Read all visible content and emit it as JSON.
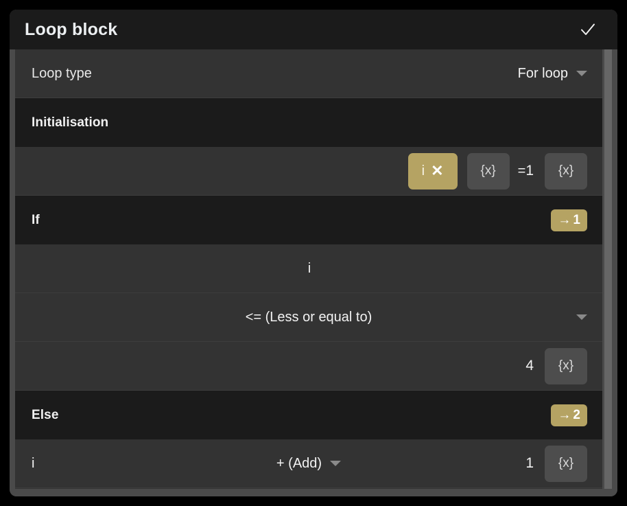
{
  "window": {
    "title": "Loop block",
    "confirm_icon": "check-icon"
  },
  "colors": {
    "accent_gold": "#b5a363",
    "panel_dark": "#1b1b1b",
    "row_bg": "#333333",
    "frame": "#4a4a4a",
    "text": "#f0f0f0"
  },
  "loop_type_row": {
    "label": "Loop type",
    "value": "For loop",
    "caret_icon": "chevron-down-icon"
  },
  "sections": {
    "initialisation": {
      "title": "Initialisation"
    },
    "if": {
      "title": "If",
      "badge_arrow": "→",
      "badge_number": "1"
    },
    "else": {
      "title": "Else",
      "badge_arrow": "→",
      "badge_number": "2"
    }
  },
  "init_row": {
    "variable_name": "i",
    "remove_icon": "✕",
    "variable_picker_label": "{x}",
    "operator": "=",
    "value": "1",
    "value_picker_label": "{x}"
  },
  "condition": {
    "left_operand": "i",
    "comparator": "<= (Less or equal to)",
    "comparator_caret": "chevron-down-icon",
    "right_value": "4",
    "right_picker_label": "{x}"
  },
  "increment": {
    "variable": "i",
    "operation": "+ (Add)",
    "operation_caret": "chevron-down-icon",
    "value": "1",
    "value_picker_label": "{x}"
  }
}
